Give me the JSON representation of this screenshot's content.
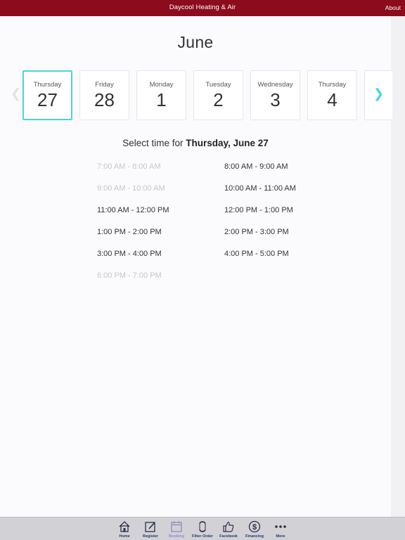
{
  "header": {
    "title": "Daycool Heating & Air",
    "about_label": "About"
  },
  "calendar": {
    "month": "June",
    "days": [
      {
        "name": "Thursday",
        "num": "27",
        "selected": true
      },
      {
        "name": "Friday",
        "num": "28"
      },
      {
        "name": "Monday",
        "num": "1"
      },
      {
        "name": "Tuesday",
        "num": "2"
      },
      {
        "name": "Wednesday",
        "num": "3"
      },
      {
        "name": "Thursday",
        "num": "4"
      }
    ]
  },
  "selection": {
    "prefix": "Select time for",
    "date": "Thursday, June 27"
  },
  "slots": {
    "left": [
      {
        "label": "7:00 AM  -  8:00 AM",
        "available": false
      },
      {
        "label": "9:00 AM  -  10:00 AM",
        "available": false
      },
      {
        "label": "11:00 AM  -  12:00 PM",
        "available": true
      },
      {
        "label": "1:00 PM  -  2:00 PM",
        "available": true
      },
      {
        "label": "3:00 PM  -  4:00 PM",
        "available": true
      },
      {
        "label": "6:00 PM  -  7:00 PM",
        "available": false
      }
    ],
    "right": [
      {
        "label": "8:00 AM  -  9:00 AM",
        "available": true
      },
      {
        "label": "10:00 AM  -  11:00 AM",
        "available": true
      },
      {
        "label": "12:00 PM  -  1:00 PM",
        "available": true
      },
      {
        "label": "2:00 PM  -  3:00 PM",
        "available": true
      },
      {
        "label": "4:00 PM  -  5:00 PM",
        "available": true
      }
    ]
  },
  "tabbar": {
    "items": [
      {
        "label": "Home",
        "icon": "home-icon"
      },
      {
        "label": "Register",
        "icon": "register-icon"
      },
      {
        "label": "Booking",
        "icon": "calendar-icon",
        "active": true
      },
      {
        "label": "Filter Order",
        "icon": "filter-icon"
      },
      {
        "label": "Facebook",
        "icon": "thumbs-up-icon"
      },
      {
        "label": "Financing",
        "icon": "dollar-icon"
      },
      {
        "label": "More",
        "icon": "more-icon"
      }
    ]
  },
  "colors": {
    "header": "#8c0c1e",
    "accent": "#4fd3d6",
    "tab_label": "#223a66"
  }
}
